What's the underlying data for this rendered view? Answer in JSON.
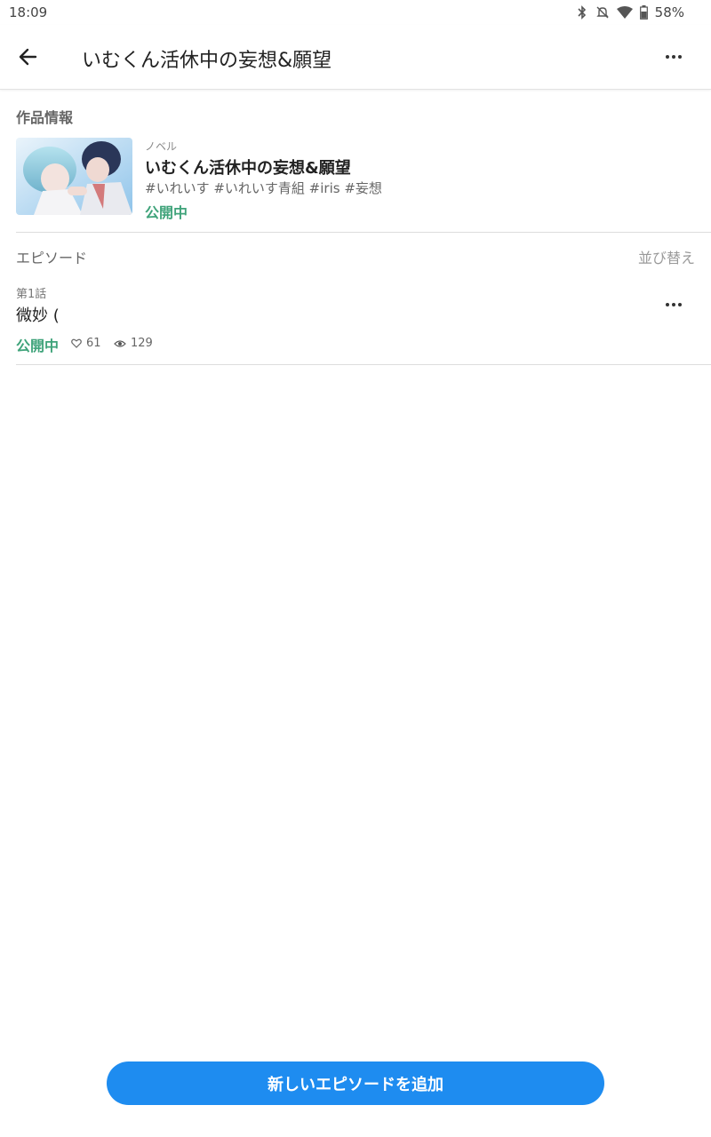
{
  "status_bar": {
    "time": "18:09",
    "battery": "58%",
    "icons": [
      "bluetooth-icon",
      "notifications-off-icon",
      "wifi-icon",
      "battery-icon"
    ]
  },
  "header": {
    "title": "いむくん活休中の妄想&願望"
  },
  "work_info": {
    "section_label": "作品情報",
    "type": "ノベル",
    "title": "いむくん活休中の妄想&願望",
    "tags": "#いれいす #いれいす青組 #iris #妄想",
    "status": "公開中"
  },
  "episodes": {
    "section_label": "エピソード",
    "sort_label": "並び替え",
    "items": [
      {
        "number": "第1話",
        "title": "微妙 (",
        "status": "公開中",
        "likes": "61",
        "views": "129"
      }
    ]
  },
  "footer": {
    "add_button_label": "新しいエピソードを追加"
  },
  "colors": {
    "accent": "#1e8cf0",
    "status_green": "#3fa37a"
  }
}
